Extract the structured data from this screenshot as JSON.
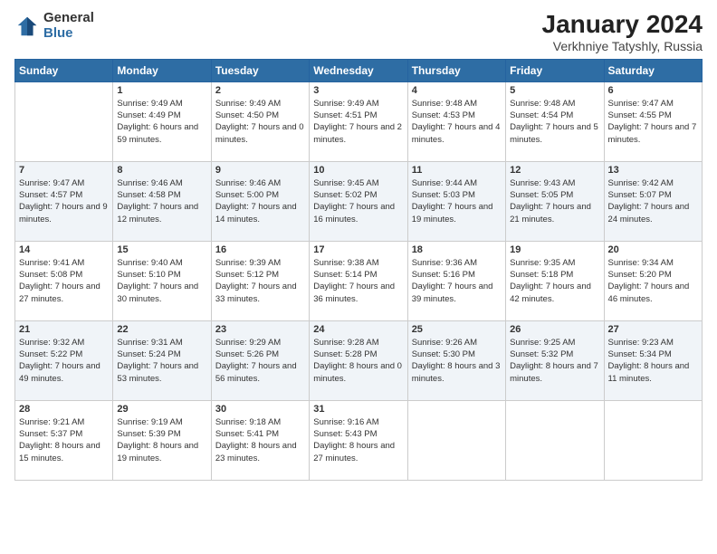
{
  "logo": {
    "general": "General",
    "blue": "Blue"
  },
  "title": "January 2024",
  "subtitle": "Verkhniye Tatyshly, Russia",
  "headers": [
    "Sunday",
    "Monday",
    "Tuesday",
    "Wednesday",
    "Thursday",
    "Friday",
    "Saturday"
  ],
  "weeks": [
    [
      {
        "day": "",
        "sunrise": "",
        "sunset": "",
        "daylight": ""
      },
      {
        "day": "1",
        "sunrise": "Sunrise: 9:49 AM",
        "sunset": "Sunset: 4:49 PM",
        "daylight": "Daylight: 6 hours and 59 minutes."
      },
      {
        "day": "2",
        "sunrise": "Sunrise: 9:49 AM",
        "sunset": "Sunset: 4:50 PM",
        "daylight": "Daylight: 7 hours and 0 minutes."
      },
      {
        "day": "3",
        "sunrise": "Sunrise: 9:49 AM",
        "sunset": "Sunset: 4:51 PM",
        "daylight": "Daylight: 7 hours and 2 minutes."
      },
      {
        "day": "4",
        "sunrise": "Sunrise: 9:48 AM",
        "sunset": "Sunset: 4:53 PM",
        "daylight": "Daylight: 7 hours and 4 minutes."
      },
      {
        "day": "5",
        "sunrise": "Sunrise: 9:48 AM",
        "sunset": "Sunset: 4:54 PM",
        "daylight": "Daylight: 7 hours and 5 minutes."
      },
      {
        "day": "6",
        "sunrise": "Sunrise: 9:47 AM",
        "sunset": "Sunset: 4:55 PM",
        "daylight": "Daylight: 7 hours and 7 minutes."
      }
    ],
    [
      {
        "day": "7",
        "sunrise": "Sunrise: 9:47 AM",
        "sunset": "Sunset: 4:57 PM",
        "daylight": "Daylight: 7 hours and 9 minutes."
      },
      {
        "day": "8",
        "sunrise": "Sunrise: 9:46 AM",
        "sunset": "Sunset: 4:58 PM",
        "daylight": "Daylight: 7 hours and 12 minutes."
      },
      {
        "day": "9",
        "sunrise": "Sunrise: 9:46 AM",
        "sunset": "Sunset: 5:00 PM",
        "daylight": "Daylight: 7 hours and 14 minutes."
      },
      {
        "day": "10",
        "sunrise": "Sunrise: 9:45 AM",
        "sunset": "Sunset: 5:02 PM",
        "daylight": "Daylight: 7 hours and 16 minutes."
      },
      {
        "day": "11",
        "sunrise": "Sunrise: 9:44 AM",
        "sunset": "Sunset: 5:03 PM",
        "daylight": "Daylight: 7 hours and 19 minutes."
      },
      {
        "day": "12",
        "sunrise": "Sunrise: 9:43 AM",
        "sunset": "Sunset: 5:05 PM",
        "daylight": "Daylight: 7 hours and 21 minutes."
      },
      {
        "day": "13",
        "sunrise": "Sunrise: 9:42 AM",
        "sunset": "Sunset: 5:07 PM",
        "daylight": "Daylight: 7 hours and 24 minutes."
      }
    ],
    [
      {
        "day": "14",
        "sunrise": "Sunrise: 9:41 AM",
        "sunset": "Sunset: 5:08 PM",
        "daylight": "Daylight: 7 hours and 27 minutes."
      },
      {
        "day": "15",
        "sunrise": "Sunrise: 9:40 AM",
        "sunset": "Sunset: 5:10 PM",
        "daylight": "Daylight: 7 hours and 30 minutes."
      },
      {
        "day": "16",
        "sunrise": "Sunrise: 9:39 AM",
        "sunset": "Sunset: 5:12 PM",
        "daylight": "Daylight: 7 hours and 33 minutes."
      },
      {
        "day": "17",
        "sunrise": "Sunrise: 9:38 AM",
        "sunset": "Sunset: 5:14 PM",
        "daylight": "Daylight: 7 hours and 36 minutes."
      },
      {
        "day": "18",
        "sunrise": "Sunrise: 9:36 AM",
        "sunset": "Sunset: 5:16 PM",
        "daylight": "Daylight: 7 hours and 39 minutes."
      },
      {
        "day": "19",
        "sunrise": "Sunrise: 9:35 AM",
        "sunset": "Sunset: 5:18 PM",
        "daylight": "Daylight: 7 hours and 42 minutes."
      },
      {
        "day": "20",
        "sunrise": "Sunrise: 9:34 AM",
        "sunset": "Sunset: 5:20 PM",
        "daylight": "Daylight: 7 hours and 46 minutes."
      }
    ],
    [
      {
        "day": "21",
        "sunrise": "Sunrise: 9:32 AM",
        "sunset": "Sunset: 5:22 PM",
        "daylight": "Daylight: 7 hours and 49 minutes."
      },
      {
        "day": "22",
        "sunrise": "Sunrise: 9:31 AM",
        "sunset": "Sunset: 5:24 PM",
        "daylight": "Daylight: 7 hours and 53 minutes."
      },
      {
        "day": "23",
        "sunrise": "Sunrise: 9:29 AM",
        "sunset": "Sunset: 5:26 PM",
        "daylight": "Daylight: 7 hours and 56 minutes."
      },
      {
        "day": "24",
        "sunrise": "Sunrise: 9:28 AM",
        "sunset": "Sunset: 5:28 PM",
        "daylight": "Daylight: 8 hours and 0 minutes."
      },
      {
        "day": "25",
        "sunrise": "Sunrise: 9:26 AM",
        "sunset": "Sunset: 5:30 PM",
        "daylight": "Daylight: 8 hours and 3 minutes."
      },
      {
        "day": "26",
        "sunrise": "Sunrise: 9:25 AM",
        "sunset": "Sunset: 5:32 PM",
        "daylight": "Daylight: 8 hours and 7 minutes."
      },
      {
        "day": "27",
        "sunrise": "Sunrise: 9:23 AM",
        "sunset": "Sunset: 5:34 PM",
        "daylight": "Daylight: 8 hours and 11 minutes."
      }
    ],
    [
      {
        "day": "28",
        "sunrise": "Sunrise: 9:21 AM",
        "sunset": "Sunset: 5:37 PM",
        "daylight": "Daylight: 8 hours and 15 minutes."
      },
      {
        "day": "29",
        "sunrise": "Sunrise: 9:19 AM",
        "sunset": "Sunset: 5:39 PM",
        "daylight": "Daylight: 8 hours and 19 minutes."
      },
      {
        "day": "30",
        "sunrise": "Sunrise: 9:18 AM",
        "sunset": "Sunset: 5:41 PM",
        "daylight": "Daylight: 8 hours and 23 minutes."
      },
      {
        "day": "31",
        "sunrise": "Sunrise: 9:16 AM",
        "sunset": "Sunset: 5:43 PM",
        "daylight": "Daylight: 8 hours and 27 minutes."
      },
      {
        "day": "",
        "sunrise": "",
        "sunset": "",
        "daylight": ""
      },
      {
        "day": "",
        "sunrise": "",
        "sunset": "",
        "daylight": ""
      },
      {
        "day": "",
        "sunrise": "",
        "sunset": "",
        "daylight": ""
      }
    ]
  ]
}
